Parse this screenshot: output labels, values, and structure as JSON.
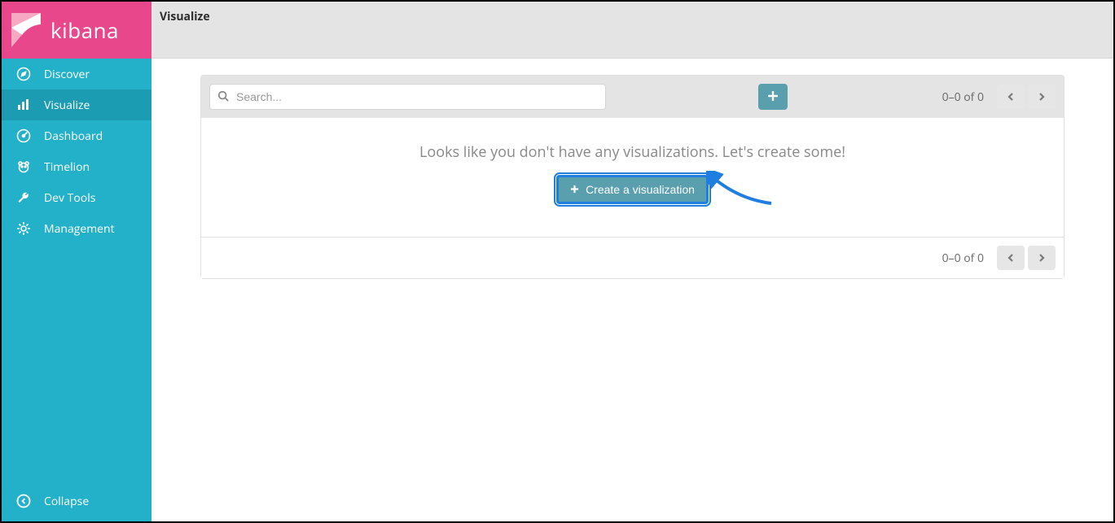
{
  "brand": {
    "name": "kibana"
  },
  "sidebar": {
    "items": [
      {
        "label": "Discover",
        "icon": "compass-icon"
      },
      {
        "label": "Visualize",
        "icon": "chart-icon"
      },
      {
        "label": "Dashboard",
        "icon": "gauge-icon"
      },
      {
        "label": "Timelion",
        "icon": "bear-icon"
      },
      {
        "label": "Dev Tools",
        "icon": "wrench-icon"
      },
      {
        "label": "Management",
        "icon": "gear-icon"
      }
    ],
    "collapse_label": "Collapse"
  },
  "topbar": {
    "title": "Visualize"
  },
  "search": {
    "placeholder": "Search..."
  },
  "pager_top": {
    "text": "0–0 of 0"
  },
  "pager_bottom": {
    "text": "0–0 of 0"
  },
  "empty": {
    "message": "Looks like you don't have any visualizations. Let's create some!",
    "create_label": "Create a visualization"
  }
}
